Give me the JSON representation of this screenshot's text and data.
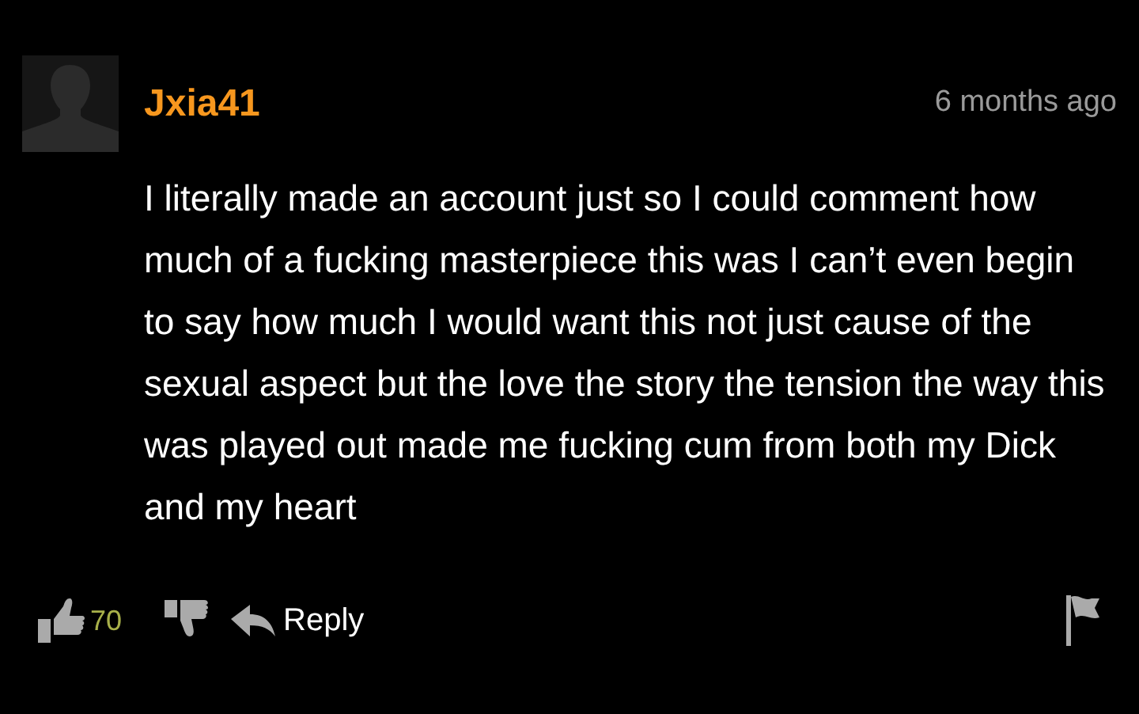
{
  "comment": {
    "username": "Jxia41",
    "time": "6 months ago",
    "text": "I literally made an account just so I could comment how much of a fucking masterpiece this was I can’t even begin to say how much I would want this not just cause of the sexual aspect but the love the story the tension the way this was played out made me fucking cum from both my Dick and my heart",
    "likes": "70",
    "reply": "Reply"
  }
}
